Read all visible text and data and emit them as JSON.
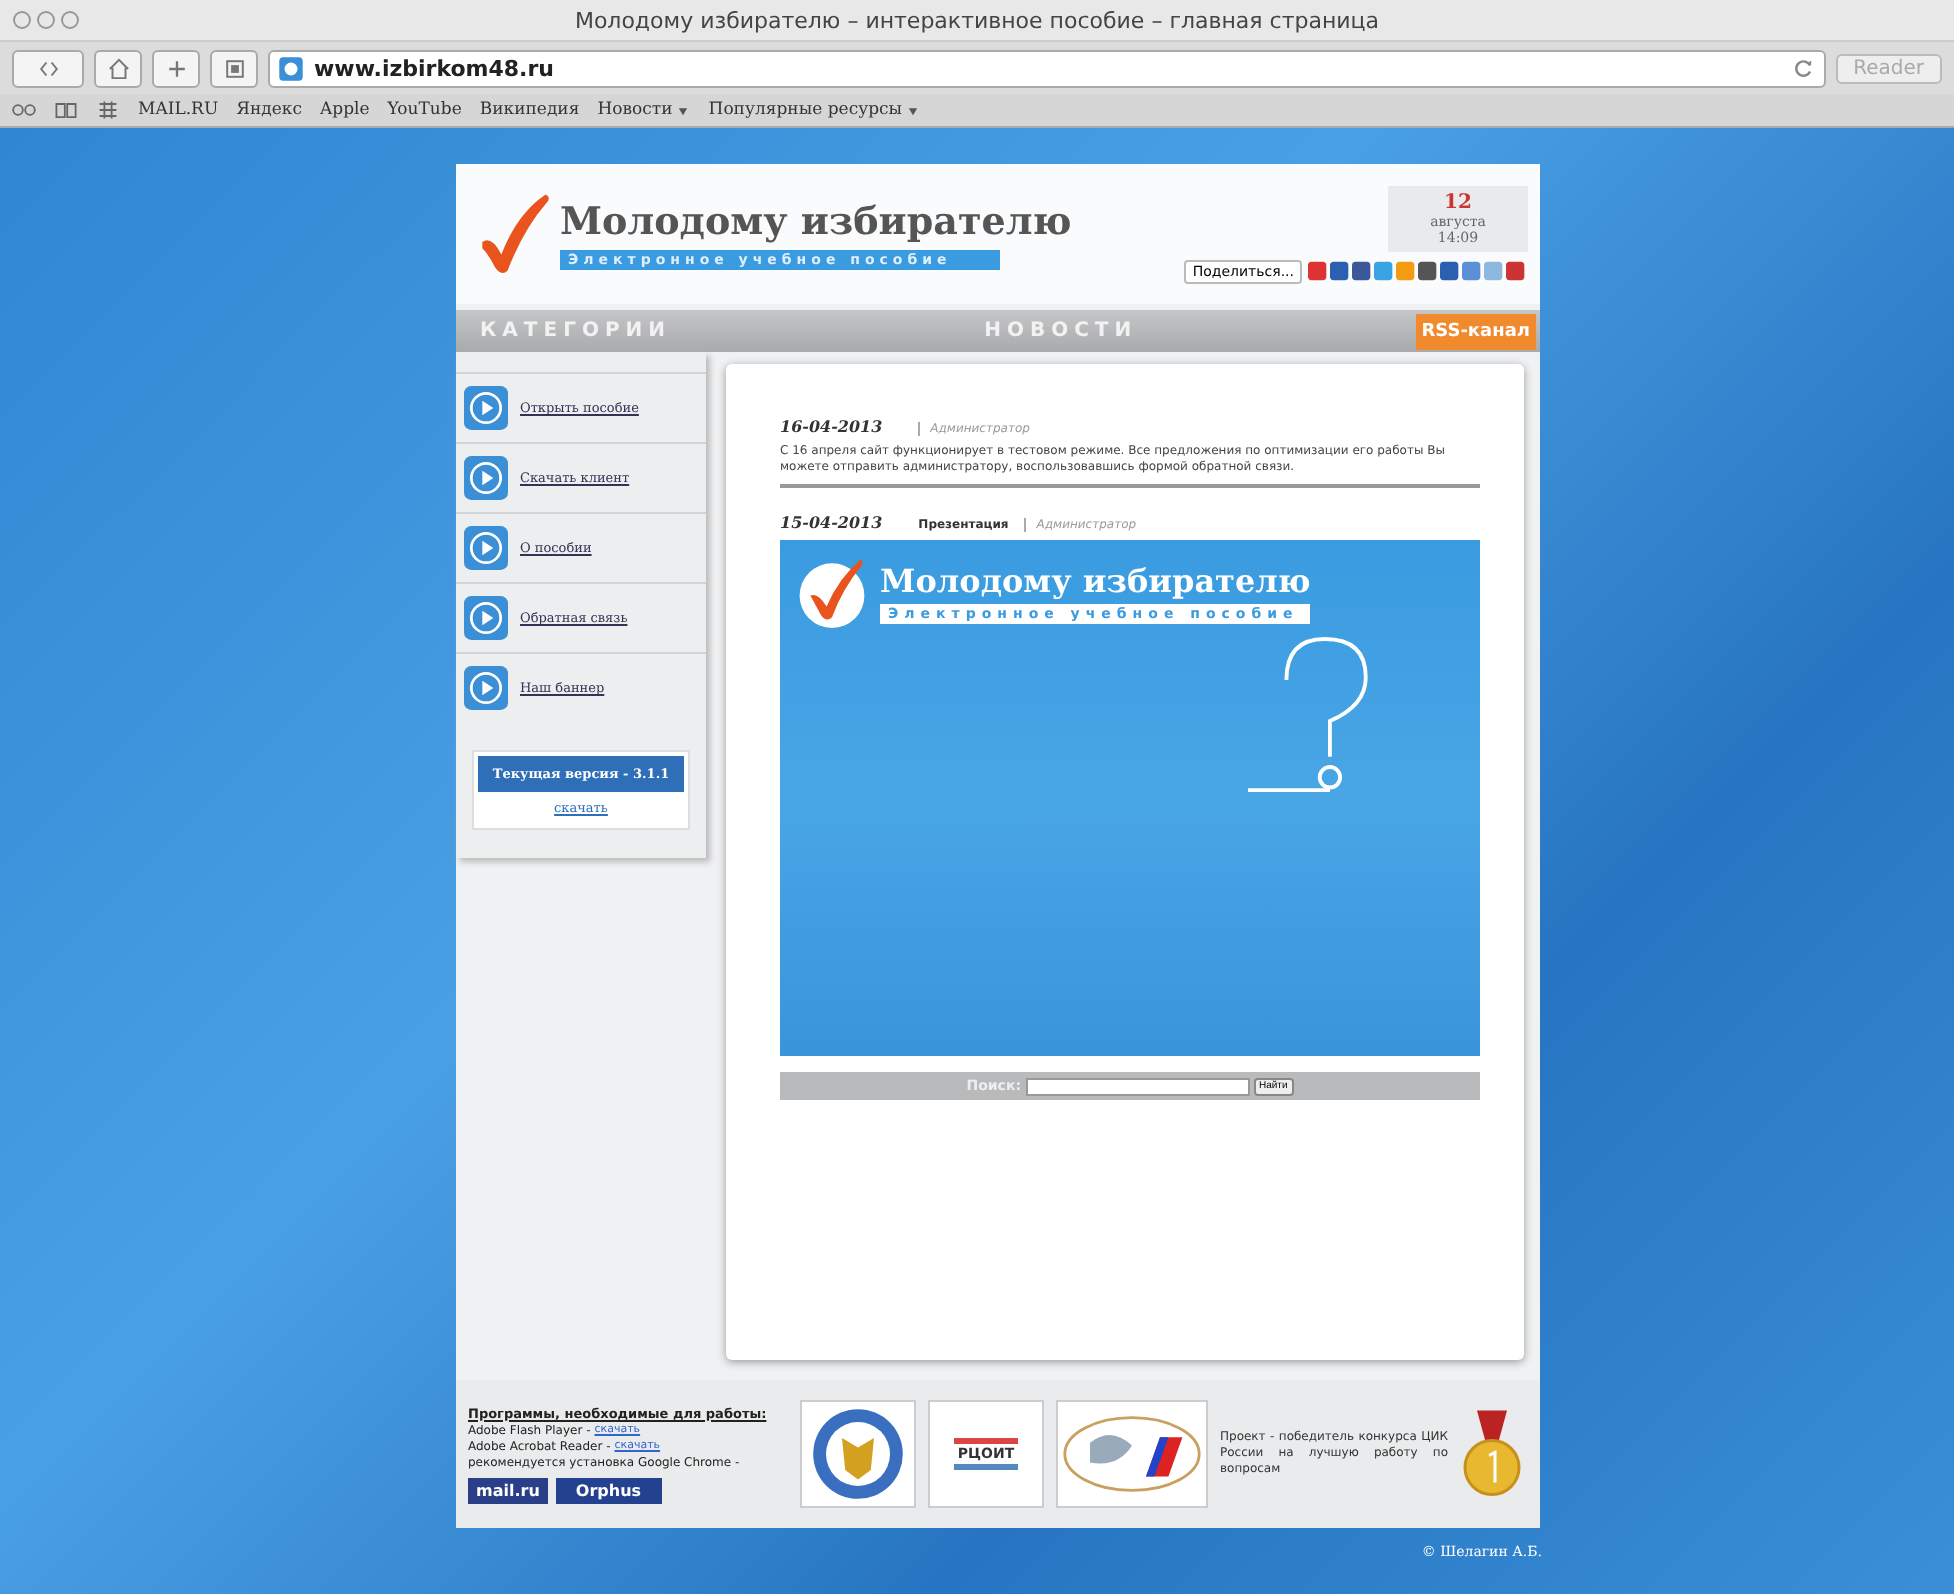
{
  "window": {
    "title": "Молодому избирателю – интерактивное пособие – главная страница"
  },
  "toolbar": {
    "address": "www.izbirkom48.ru",
    "reader_button": "Reader"
  },
  "bookmarks": [
    {
      "label": "MAIL.RU",
      "menu": false
    },
    {
      "label": "Яндекс",
      "menu": false
    },
    {
      "label": "Apple",
      "menu": false
    },
    {
      "label": "YouTube",
      "menu": false
    },
    {
      "label": "Википедия",
      "menu": false
    },
    {
      "label": "Новости",
      "menu": true
    },
    {
      "label": "Популярные ресурсы",
      "menu": true
    }
  ],
  "header": {
    "title": "Молодому избирателю",
    "subtitle": "Электронное учебное пособие",
    "date": {
      "day": "12",
      "month": "августа",
      "time": "14:09"
    },
    "share_button": "Поделиться..."
  },
  "nav": {
    "categories": "КАТЕГОРИИ",
    "news": "НОВОСТИ",
    "rss": "RSS-канал"
  },
  "sidebar": {
    "items": [
      "Открыть пособие",
      "Скачать клиент",
      "О пособии",
      "Обратная связь",
      "Наш баннер"
    ],
    "version": "Текущая версия - 3.1.1",
    "download": "скачать"
  },
  "news": [
    {
      "date": "16-04-2013",
      "author": "Администратор",
      "text": "С 16 апреля сайт функционирует в тестовом режиме. Все предложения по оптимизации его работы Вы можете отправить администратору, воспользовавшись формой обратной связи."
    },
    {
      "date": "15-04-2013",
      "category": "Презентация",
      "author": "Администратор",
      "banner": {
        "title": "Молодому избирателю",
        "subtitle": "Электронное учебное пособие"
      }
    }
  ],
  "search": {
    "label": "Поиск:",
    "button": "Найти"
  },
  "footer": {
    "heading": "Программы, необходимые для работы:",
    "lines": [
      {
        "text": "Adobe Flash Player -",
        "link": "скачать"
      },
      {
        "text": "Adobe Acrobat Reader -",
        "link": "скачать"
      },
      {
        "text": "рекомендуется установка Google Chrome -"
      }
    ],
    "badges": [
      "mail.ru",
      "Orphus"
    ],
    "logo_text": "РЦОИТ",
    "award": "Проект - победитель конкурса ЦИК России на лучшую работу по вопросам"
  },
  "copyright": "© Шелагин А.Б."
}
